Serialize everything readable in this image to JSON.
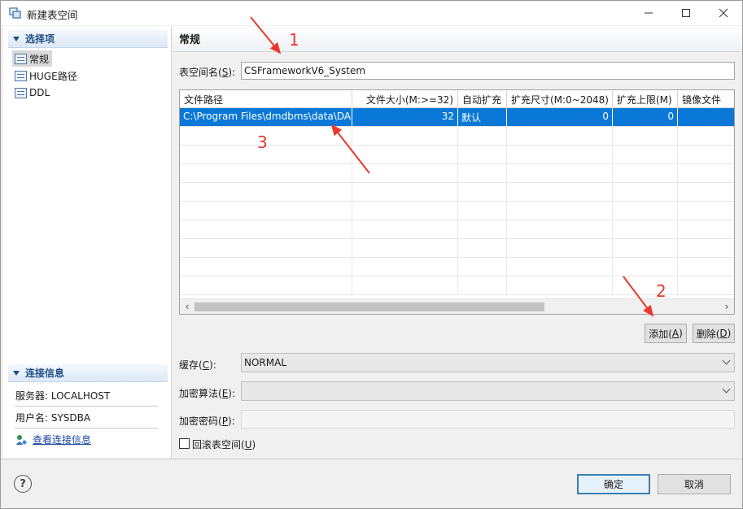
{
  "window": {
    "title": "新建表空间",
    "minimize_glyph": "—",
    "maximize_glyph": "☐",
    "close_glyph": "✕"
  },
  "sidebar": {
    "section_title": "选择项",
    "items": [
      {
        "label": "常规",
        "icon": "table-icon",
        "selected": true
      },
      {
        "label": "HUGE路径",
        "icon": "table-icon",
        "selected": false
      },
      {
        "label": "DDL",
        "icon": "table-icon",
        "selected": false
      }
    ],
    "conn_section_title": "连接信息",
    "server_line": "服务器: LOCALHOST",
    "user_line": "用户名: SYSDBA",
    "view_conn_link": "查看连接信息"
  },
  "main": {
    "page_title": "常规",
    "tablespace_label": "表空间名(",
    "tablespace_key": "S",
    "tablespace_label_end": "):",
    "tablespace_value": "CSFrameworkV6_System",
    "table": {
      "columns": [
        "文件路径",
        "文件大小(M:>=32)",
        "自动扩充",
        "扩充尺寸(M:0~2048)",
        "扩充上限(M)",
        "镜像文件"
      ],
      "rows": [
        [
          "C:\\Program Files\\dmdbms\\data\\DA",
          "32",
          "默认",
          "0",
          "0",
          ""
        ]
      ],
      "scroll_left": "‹",
      "scroll_right": "›"
    },
    "add_button": {
      "label": "添加(",
      "key": "A",
      "end": ")"
    },
    "delete_button": {
      "label": "删除(",
      "key": "D",
      "end": ")"
    },
    "cache_label": "缓存(",
    "cache_key": "C",
    "cache_label_end": "):",
    "cache_value": "NORMAL",
    "encrypt_algo_label": "加密算法(",
    "encrypt_algo_key": "E",
    "encrypt_algo_end": "):",
    "encrypt_algo_value": "",
    "encrypt_pwd_label": "加密密码(",
    "encrypt_pwd_key": "P",
    "encrypt_pwd_end": "):",
    "rollback_label": "回滚表空间(",
    "rollback_key": "U",
    "rollback_end": ")",
    "rollback_checked": false
  },
  "footer": {
    "help_glyph": "?",
    "ok_label": "确定",
    "cancel_label": "取消"
  },
  "annotations": {
    "marker_1": "1",
    "marker_2": "2",
    "marker_3": "3",
    "color": "#e8392c"
  },
  "colors": {
    "selection": "#0a78d7",
    "section_header_text": "#1f4f86",
    "link": "#1a47a3"
  }
}
